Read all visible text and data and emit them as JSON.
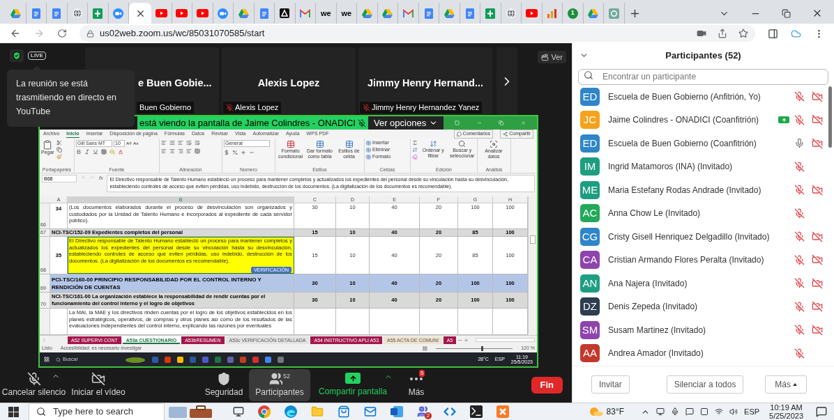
{
  "browser": {
    "tabs": [
      {
        "kind": "drive",
        "selected": false
      },
      {
        "kind": "docs",
        "selected": false
      },
      {
        "kind": "docs",
        "selected": false
      },
      {
        "kind": "globe",
        "selected": false
      },
      {
        "kind": "sheets",
        "selected": false
      },
      {
        "kind": "zoom",
        "selected": false
      },
      {
        "selected": true
      },
      {
        "kind": "youtube",
        "selected": false
      },
      {
        "kind": "youtube",
        "selected": false
      },
      {
        "kind": "youtube",
        "selected": false
      },
      {
        "kind": "zoom",
        "selected": false
      },
      {
        "kind": "drive",
        "selected": false
      },
      {
        "kind": "docs",
        "selected": false
      },
      {
        "kind": "dark",
        "selected": false
      },
      {
        "kind": "gmail",
        "selected": false
      },
      {
        "kind": "text",
        "label": "we",
        "selected": false
      },
      {
        "kind": "text",
        "label": "we",
        "selected": false
      },
      {
        "kind": "drive",
        "selected": false
      },
      {
        "kind": "drive",
        "selected": false
      },
      {
        "kind": "gmail",
        "selected": false
      },
      {
        "kind": "docs",
        "selected": false
      },
      {
        "kind": "drive",
        "selected": false
      },
      {
        "kind": "docs",
        "selected": false
      },
      {
        "kind": "sheets",
        "selected": false
      },
      {
        "kind": "globe",
        "selected": false
      },
      {
        "kind": "youtube",
        "selected": false
      },
      {
        "kind": "chart",
        "selected": false
      },
      {
        "kind": "number",
        "label": "1",
        "selected": false
      },
      {
        "kind": "drive",
        "selected": false
      },
      {
        "kind": "ai",
        "selected": false
      }
    ],
    "url": "us02web.zoom.us/wc/85031070585/start"
  },
  "meeting": {
    "live_badge": "LIVE",
    "tooltip": "La reunión se está trasmitiendo en directo en YouTube",
    "view_button": "Ver",
    "tiles": [
      {
        "name": "e Buen Gobie...",
        "label": "Buen Gobierno",
        "muted": false
      },
      {
        "name": "Alexis Lopez",
        "label": "Alexis Lopez",
        "muted": true
      },
      {
        "name": "Jimmy Henry Hernand...",
        "label": "Jimmy Henry Hernandez Yanez",
        "muted": true
      }
    ],
    "share_banner": {
      "text": "está viendo la pantalla de Jaime Colindres - ONADICI",
      "muted": true,
      "options": "Ver opciones"
    },
    "toolbar": [
      {
        "kind": "audio",
        "label": "Cancelar silencio",
        "muted": true,
        "caret": true
      },
      {
        "kind": "video",
        "label": "Iniciar el vídeo",
        "off": true,
        "caret": false
      },
      {
        "kind": "security",
        "label": "Seguridad"
      },
      {
        "kind": "participants",
        "label": "Participantes",
        "count": "52",
        "selected": true
      },
      {
        "kind": "share",
        "label": "Compartir pantalla",
        "caret": true
      },
      {
        "kind": "more",
        "label": "Más",
        "badge": "5"
      },
      {
        "kind": "end",
        "label": "Fin"
      }
    ]
  },
  "excel": {
    "menu": [
      {
        "label": "Archivo",
        "selected": false
      },
      {
        "label": "Inicio",
        "selected": true
      },
      {
        "label": "Insertar",
        "selected": false
      },
      {
        "label": "Disposición de página",
        "selected": false
      },
      {
        "label": "Fórmulas",
        "selected": false
      },
      {
        "label": "Datos",
        "selected": false
      },
      {
        "label": "Revisar",
        "selected": false
      },
      {
        "label": "Vista",
        "selected": false
      },
      {
        "label": "Automatizar",
        "selected": false
      },
      {
        "label": "Ayuda",
        "selected": false
      },
      {
        "label": "WPS PDF",
        "selected": false
      }
    ],
    "comments": "Comentarios",
    "share": "Compartir",
    "ribbon": {
      "paste": "Pegar",
      "font": "Gill Sans MT",
      "size": "10",
      "number_format": "General",
      "styles": [
        "Formato condicional",
        "Dar formato como tabla",
        "Estilos de celda"
      ],
      "cells": [
        "Insertar",
        "Eliminar",
        "Formato"
      ],
      "editing": [
        "Ordenar y filtrar",
        "Buscar y seleccionar"
      ],
      "analysis": "Analizar datos",
      "groups": [
        "Portapapeles",
        "Fuente",
        "Alineación",
        "Número",
        "Estilos",
        "Celdas",
        "Edición",
        "Análisis"
      ]
    },
    "name_box": "B68",
    "fx_label": "fx",
    "formula": "El Directivo responsable de Talento Humano estableció un proceso para mantener completos y actualizados los expedientes del personal desde su vinculación hasta su desvinculación, estableciendo controles de acceso que eviten pérdidas, uso indebido, destrucción de los documentos. (La digitalización de los documentos es recomendable).",
    "columns": [
      {
        "label": "A",
        "selected": false
      },
      {
        "label": "B",
        "selected": true
      },
      {
        "label": "C",
        "selected": false
      },
      {
        "label": "D",
        "selected": false
      },
      {
        "label": "E",
        "selected": false
      },
      {
        "label": "F",
        "selected": false
      },
      {
        "label": "G",
        "selected": false
      },
      {
        "label": "H",
        "selected": false
      }
    ],
    "rows": [
      {
        "kind": "item",
        "number": "66",
        "a": "34",
        "b": "(Los documentos elaborados durante el proceso de desvinculación son organizados y custodiados por la Unidad de Talento Humano e incorporados al expediente de cada servidor público).",
        "values": [
          "30",
          "10",
          "40",
          "20",
          "100",
          "100"
        ],
        "selected": false,
        "highlighted": false
      },
      {
        "kind": "subheader",
        "number": "67",
        "b": "NCI-TSC/152-09 Expedientes completos del personal",
        "values": [
          "15",
          "10",
          "40",
          "20",
          "85",
          "100"
        ],
        "selected": false
      },
      {
        "kind": "item",
        "number": "68",
        "a": "35",
        "b": "El Directivo responsable de Talento Humano estableció un proceso para mantener completos y actualizados los expedientes del personal desde su vinculación hasta su desvinculación, estableciendo controles de acceso que eviten pérdidas, uso indebido, destrucción de los documentos. (La digitalización de los documentos es recomendable).",
        "values": [
          "15",
          "10",
          "40",
          "20",
          "85",
          "100"
        ],
        "selected": true,
        "highlighted": true,
        "button": "VERIFICACIÓN"
      },
      {
        "kind": "principle",
        "number": "69",
        "b": "PCI-TSC/160-00 PRINCIPIO RESPONSABILIDAD POR EL CONTROL INTERNO Y RENDICIÓN DE CUENTAS",
        "values": [
          "30",
          "10",
          "40",
          "20",
          "100",
          "100"
        ],
        "selected": false
      },
      {
        "kind": "subheader",
        "number": "70",
        "b": "NCI-TSC/161-00 La organización establece la responsabilidad de rendir cuentas por el funcionamiento del control interno y el logro de objetivos",
        "values": [
          "30",
          "10",
          "40",
          "20",
          "100",
          "100"
        ],
        "selected": false
      },
      {
        "kind": "item",
        "b": "La MAI, la MAE y los directivos rinden cuentas por el logro de los objetivos establecidos en los planes estratégicos, operativos, de compras y otros planes así como de los resultados de las evaluaciones independientes del control interno, explicando las razones por eventuales",
        "selected": false,
        "highlighted": false
      }
    ],
    "sheets": [
      {
        "label": "A52 SUPERVI CONT",
        "selected": false,
        "color": "#a3174c"
      },
      {
        "label": "A53a CUESTIONARIO",
        "selected": true,
        "color": "#ffffff"
      },
      {
        "label": "A53bRESUMEN",
        "selected": false,
        "color": "#a3174c"
      },
      {
        "label": "A53c VERIFICACIÓN DETALLADA",
        "selected": false,
        "color": "#e4e4e4"
      },
      {
        "label": "A54 INSTRUCTIVO APLI A53",
        "selected": false,
        "color": "#a3174c"
      },
      {
        "label": "A55 ACTA DE COMUNI",
        "selected": false,
        "color": "#efe3d0"
      },
      {
        "label": "A5",
        "selected": false,
        "color": "#a3174c"
      }
    ],
    "status": "Listo",
    "accessibility": "Accesibilidad: es necesario investigar",
    "zoom_slider": {
      "level": 0.6
    },
    "zoom": "120 %",
    "taskbar": {
      "search": "Buscar",
      "weather": "28°C",
      "lang": "ESP",
      "time": "11:19",
      "date": "25/5/2023"
    }
  },
  "participants": {
    "title": "Participantes (52)",
    "search_placeholder": "Encontrar un participante",
    "items": [
      {
        "initials": "ED",
        "name": "Escuela de Buen Gobierno (Anfitrión, Yo)",
        "color": "#2e86c9",
        "muted": true,
        "camera_off": true,
        "sharing": false
      },
      {
        "initials": "JC",
        "name": "Jaime Colindres - ONADICI (Coanfitrión)",
        "color": "#f5a21c",
        "muted": true,
        "camera_off": true,
        "sharing": true
      },
      {
        "initials": "ED",
        "name": "Escuela de Buen Gobierno (Coanfitrión)",
        "color": "#2e86c9",
        "muted": false,
        "camera_off": true,
        "sharing": false
      },
      {
        "initials": "IM",
        "name": "Ingrid Matamoros (INA) (Invitado)",
        "color": "#1e9e80",
        "muted": true,
        "camera_off": false,
        "sharing": false
      },
      {
        "initials": "ME",
        "name": "Maria Estefany Rodas Andrade (Invitado)",
        "color": "#1e9e80",
        "muted": true,
        "camera_off": true,
        "sharing": false
      },
      {
        "initials": "AC",
        "name": "Anna Chow Le (Invitado)",
        "color": "#22a85a",
        "muted": true,
        "camera_off": false,
        "sharing": false
      },
      {
        "initials": "CG",
        "name": "Cristy Gisell Henriquez Delgadillo (Invitado)",
        "color": "#2e86c9",
        "muted": true,
        "camera_off": true,
        "sharing": false
      },
      {
        "initials": "CA",
        "name": "Cristian Armando Flores Peralta (Invitado)",
        "color": "#8e44ad",
        "muted": true,
        "camera_off": true,
        "sharing": false
      },
      {
        "initials": "AN",
        "name": "Ana Najera (Invitado)",
        "color": "#1e9e80",
        "muted": true,
        "camera_off": true,
        "sharing": false
      },
      {
        "initials": "DZ",
        "name": "Denis Zepeda (Invitado)",
        "color": "#2c3e50",
        "muted": true,
        "camera_off": true,
        "sharing": false
      },
      {
        "initials": "SM",
        "name": "Susam Martinez (Invitado)",
        "color": "#8e44ad",
        "muted": true,
        "camera_off": true,
        "sharing": false
      },
      {
        "initials": "AA",
        "name": "Andrea Amador (Invitado)",
        "color": "#c0392b",
        "muted": true,
        "camera_off": false,
        "sharing": false
      }
    ],
    "buttons": [
      "Invitar",
      "Silenciar a todos",
      "Más"
    ]
  },
  "taskbar": {
    "search": "Type here to search",
    "apps": [
      {
        "kind": "taskview"
      },
      {
        "kind": "chrome"
      },
      {
        "kind": "edge"
      },
      {
        "kind": "explorer"
      },
      {
        "kind": "store"
      },
      {
        "kind": "mail"
      },
      {
        "kind": "word"
      },
      {
        "kind": "teams",
        "badge": "2"
      },
      {
        "kind": "vscode"
      },
      {
        "kind": "terminal"
      },
      {
        "kind": "xampp"
      }
    ],
    "weather": "83°F",
    "lang": "ESP",
    "time": "10:19 AM",
    "date": "5/25/2023"
  }
}
